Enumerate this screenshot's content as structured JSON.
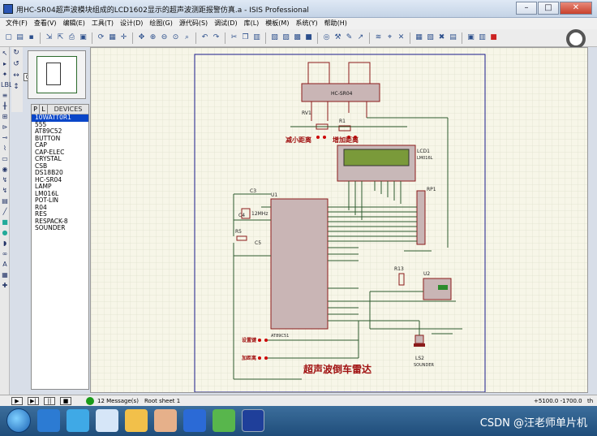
{
  "window": {
    "title": "用HC-SR04超声波模块组成的LCD1602显示的超声波测距报警仿真.a - ISIS Professional",
    "minimize_label": "–",
    "maximize_label": "□",
    "close_label": "✕"
  },
  "menu": [
    "文件(F)",
    "查看(V)",
    "编辑(E)",
    "工具(T)",
    "设计(D)",
    "绘图(G)",
    "源代码(S)",
    "调试(D)",
    "库(L)",
    "模板(M)",
    "系统(Y)",
    "帮助(H)"
  ],
  "device_panel": {
    "p_label": "P",
    "l_label": "L",
    "header": "DEVICES",
    "items": [
      "10WATT0R1",
      "555",
      "AT89C52",
      "BUTTON",
      "CAP",
      "CAP-ELEC",
      "CRYSTAL",
      "CSB",
      "DS18B20",
      "HC-SR04",
      "LAMP",
      "LM016L",
      "POT-LIN",
      "R04",
      "RES",
      "RESPACK-8",
      "SOUNDER"
    ],
    "selected_index": 0
  },
  "schematic": {
    "sensor": "HC-SR04",
    "rv1": "RV1",
    "r1": "R1",
    "decrease_label": "减小距离",
    "increase_label": "增加距离",
    "lcd": "LCD1",
    "lcd_model": "LM016L",
    "rp1": "RP1",
    "u1": "U1",
    "mcu": "AT89C51",
    "c3": "C3",
    "c4": "C4",
    "crystal": "12MHz",
    "r5": "R5",
    "c5": "C5",
    "r13": "R13",
    "u2": "U2",
    "ls2": "LS2",
    "sounder": "SOUNDER",
    "button1": "设置键",
    "button2": "加距离",
    "main_title": "超声波倒车雷达"
  },
  "status": {
    "messages": "12 Message(s)",
    "sheet": "Root sheet 1",
    "coords": "+5100.0  -1700.0",
    "unit": "th"
  },
  "watermark": "CSDN @汪老师单片机"
}
